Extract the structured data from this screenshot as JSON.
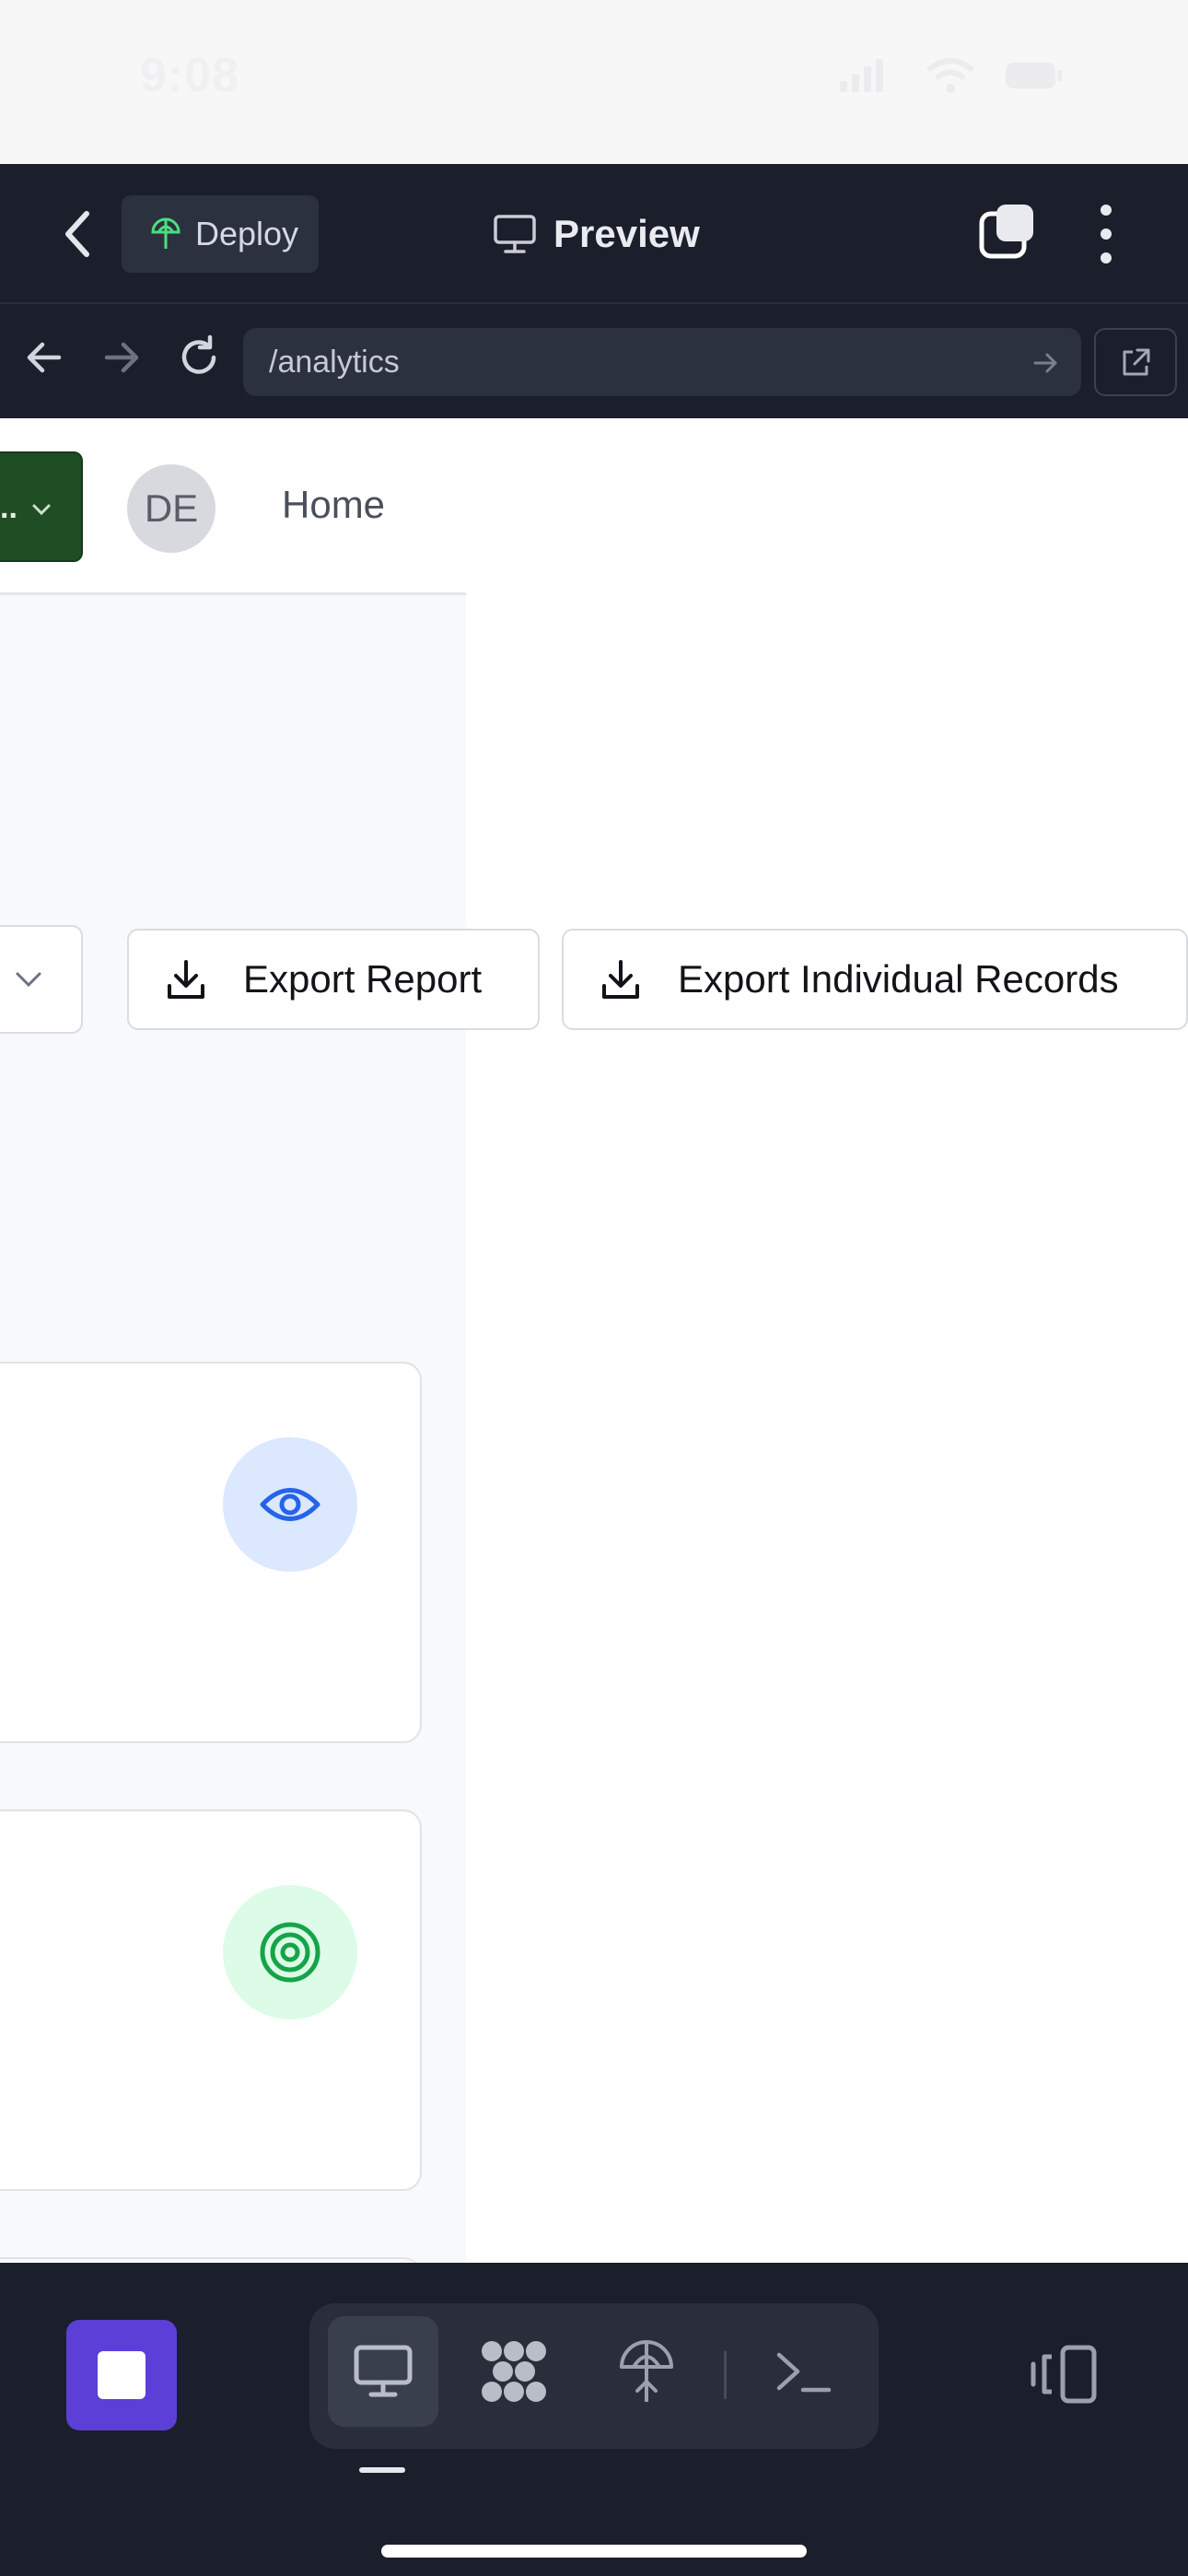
{
  "status_bar": {
    "time": "9:08"
  },
  "app_bar": {
    "deploy_label": "Deploy",
    "preview_label": "Preview"
  },
  "url_bar": {
    "url": "/analytics"
  },
  "page": {
    "header": {
      "workspace_label": "..",
      "avatar_initials": "DE",
      "home_label": "Home"
    },
    "export_report_label": "Export Report",
    "export_records_label": "Export Individual Records",
    "cards": [
      {
        "icon": "eye-icon",
        "badge_color": "#dbe8fd",
        "icon_color": "#2563eb"
      },
      {
        "icon": "target-icon",
        "badge_color": "#dcfce7",
        "icon_color": "#16a34a"
      }
    ]
  },
  "bottom_bar": {
    "tools": [
      "monitor-icon",
      "network-icon",
      "deploy-icon",
      "terminal-icon"
    ],
    "active_tool": "monitor-icon"
  },
  "colors": {
    "dark_bg": "#1b1f2b",
    "accent_purple": "#5b3fd6",
    "workspace_green": "#1f4d24"
  }
}
